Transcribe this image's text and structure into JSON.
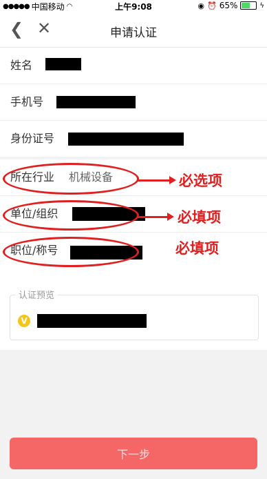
{
  "status_bar": {
    "carrier": "中国移动",
    "time": "上午9:08",
    "battery_text": "65%",
    "battery_level": 0.65
  },
  "nav": {
    "title": "申请认证",
    "back_icon": "chevron-left-icon",
    "close_icon": "close-icon"
  },
  "personal_info": {
    "name_label": "姓名",
    "phone_label": "手机号",
    "id_label": "身份证号"
  },
  "work_info": {
    "industry_label": "所在行业",
    "industry_value": "机械设备",
    "org_label": "单位/组织",
    "title_label": "职位/称号"
  },
  "annotations": {
    "required_select": "必选项",
    "required_fill_1": "必填项",
    "required_fill_2": "必填项",
    "color": "#e02020"
  },
  "preview": {
    "legend": "认证预览",
    "badge": "V"
  },
  "actions": {
    "next_label": "下一步",
    "next_color": "#f56767"
  }
}
